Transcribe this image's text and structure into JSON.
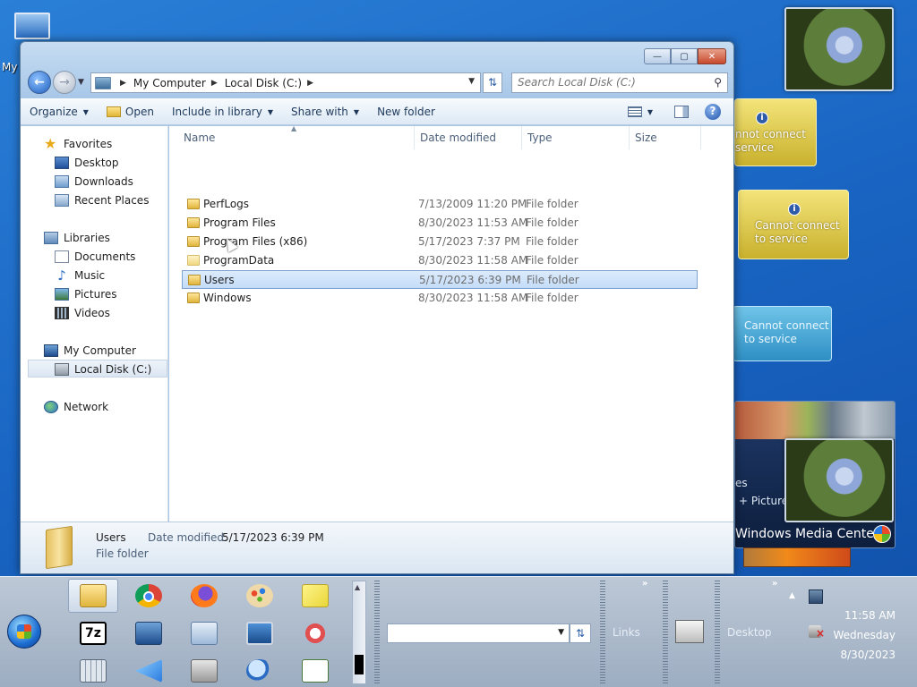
{
  "desktop": {
    "icon_label": "My"
  },
  "gadgets": {
    "weather1_line1": "nnot connect",
    "weather1_line2": "service",
    "weather2_line1": "Cannot connect",
    "weather2_line2": "to service",
    "blue_line1": "Cannot connect",
    "blue_line2": "to service",
    "wmc_fragment": "es",
    "wmc_pictures": "+ Picture",
    "wmc_title_bold": "Windows",
    "wmc_title_rest": " Media Center"
  },
  "window": {
    "caption": {
      "minimize": "—",
      "maximize": "▢",
      "close": "✕"
    },
    "address": {
      "crumbs": [
        "My Computer",
        "Local Disk (C:)"
      ]
    },
    "search_placeholder": "Search Local Disk (C:)",
    "commands": {
      "organize": "Organize",
      "open": "Open",
      "include": "Include in library",
      "share": "Share with",
      "new_folder": "New folder",
      "help": "?"
    },
    "nav": {
      "favorites": "Favorites",
      "desktop": "Desktop",
      "downloads": "Downloads",
      "recent": "Recent Places",
      "libraries": "Libraries",
      "documents": "Documents",
      "music": "Music",
      "pictures": "Pictures",
      "videos": "Videos",
      "computer": "My Computer",
      "local_disk": "Local Disk (C:)",
      "network": "Network"
    },
    "columns": {
      "name": "Name",
      "date": "Date modified",
      "type": "Type",
      "size": "Size"
    },
    "files": [
      {
        "name": "PerfLogs",
        "date": "7/13/2009 11:20 PM",
        "type": "File folder"
      },
      {
        "name": "Program Files",
        "date": "8/30/2023 11:53 AM",
        "type": "File folder"
      },
      {
        "name": "Program Files (x86)",
        "date": "5/17/2023 7:37 PM",
        "type": "File folder"
      },
      {
        "name": "ProgramData",
        "date": "8/30/2023 11:58 AM",
        "type": "File folder"
      },
      {
        "name": "Users",
        "date": "5/17/2023 6:39 PM",
        "type": "File folder"
      },
      {
        "name": "Windows",
        "date": "8/30/2023 11:58 AM",
        "type": "File folder"
      }
    ],
    "details": {
      "name": "Users",
      "type": "File folder",
      "date_label": "Date modified:",
      "date_value": "5/17/2023 6:39 PM"
    }
  },
  "taskbar": {
    "seven_zip": "7z",
    "links": "Links",
    "desktop": "Desktop",
    "chevron": "»",
    "clock": {
      "time": "11:58 AM",
      "day": "Wednesday",
      "date": "8/30/2023"
    }
  }
}
